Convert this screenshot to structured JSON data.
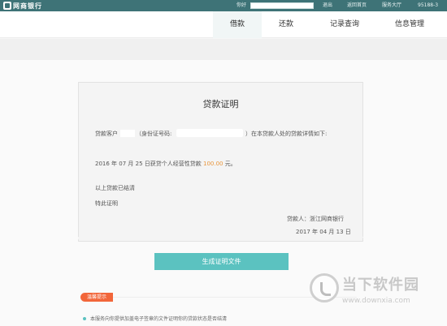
{
  "topbar": {
    "logo_text": "网商银行",
    "greeting": "你好",
    "logout": "退出",
    "back_home": "返回首页",
    "service_hall": "服务大厅",
    "phone": "95188-3"
  },
  "nav": {
    "tabs": [
      {
        "label": "借款",
        "active": true
      },
      {
        "label": "还款",
        "active": false
      },
      {
        "label": "记录查询",
        "active": false
      },
      {
        "label": "信息管理",
        "active": false
      }
    ]
  },
  "certificate": {
    "title": "贷款证明",
    "customer_prefix": "贷款客户",
    "id_label": "（身份证号码:",
    "id_suffix": "）在本贷款人处的贷款详情如下:",
    "loan_line_prefix": "2016 年 07 月 25 日获贷个人经营性贷款",
    "amount": "100.00",
    "amount_unit": "元。",
    "settled": "以上贷款已结清",
    "hereby": "特此证明",
    "lender": "贷款人：浙江网商银行",
    "date": "2017 年 04 月 13 日"
  },
  "actions": {
    "generate_button": "生成证明文件"
  },
  "tips": {
    "badge": "温馨提示",
    "item": "本服务向你提供加盖电子签章的文件证明你的贷款状态是否结清"
  },
  "watermark": {
    "name": "当下软件园",
    "url": "www.downxia.com"
  }
}
